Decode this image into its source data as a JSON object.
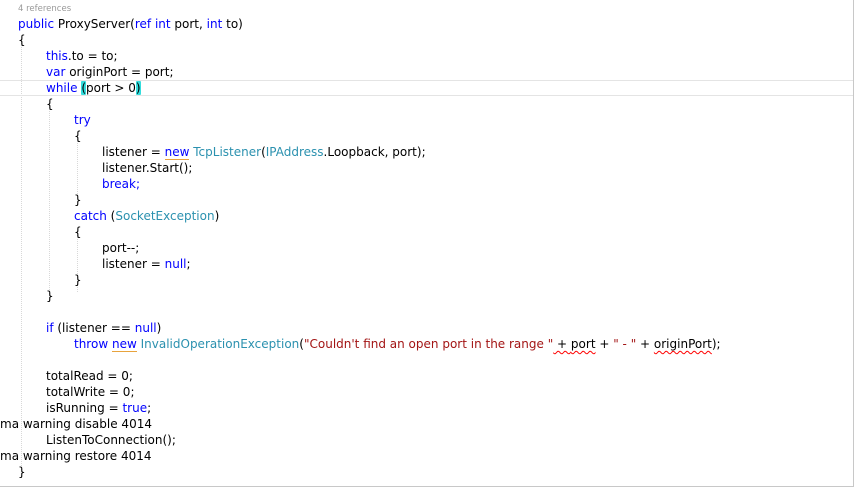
{
  "codelens": "4 references",
  "code": {
    "signature": {
      "kw_public": "public",
      "name": " ProxyServer(",
      "kw_ref": "ref",
      "sp1": " ",
      "kw_int1": "int",
      "p_port": " port, ",
      "kw_int2": "int",
      "p_to": " to)"
    },
    "open_brace": "{",
    "l_this": {
      "kw": "this",
      "rest": ".to = to;"
    },
    "l_var": {
      "kw": "var",
      "rest": " originPort = port;"
    },
    "l_while": {
      "kw": "while",
      "sp": " ",
      "open": "(",
      "cond": "port > 0",
      "close": ")"
    },
    "while_open": "{",
    "try_kw": "try",
    "try_open": "{",
    "l_listener": {
      "a": "listener = ",
      "kw_new": "new",
      "sp": " ",
      "type": "TcpListener",
      "b": "(",
      "type2": "IPAddress",
      "c": ".Loopback, port);"
    },
    "l_start": "listener.Start();",
    "break_kw": "break;",
    "try_close": "}",
    "l_catch": {
      "kw": "catch",
      "a": " (",
      "type": "SocketException",
      "b": ")"
    },
    "catch_open": "{",
    "l_portdec": "port--;",
    "l_null": {
      "a": "listener = ",
      "kw": "null",
      "b": ";"
    },
    "catch_close": "}",
    "while_close": "}",
    "l_if": {
      "kw": "if",
      "a": " (listener == ",
      "kw_null": "null",
      "b": ")"
    },
    "l_throw": {
      "kw_throw": "throw",
      "sp1": " ",
      "kw_new": "new",
      "sp2": " ",
      "type": "InvalidOperationException",
      "a": "(",
      "str1": "\"Couldn't find an open port in the range \"",
      "op1": " + ",
      "var1": "port",
      "op2": " + ",
      "str2": "\" - \"",
      "op3": " + ",
      "var2": "originPort",
      "b": ");"
    },
    "l_totalread": "totalRead = 0;",
    "l_totalwrite": "totalWrite = 0;",
    "l_isrunning": {
      "a": "isRunning = ",
      "kw": "true",
      "b": ";"
    },
    "l_pragma1": "ma warning disable 4014",
    "l_listen": "ListenToConnection();",
    "l_pragma2": "ma warning restore 4014",
    "close_brace": "}"
  }
}
